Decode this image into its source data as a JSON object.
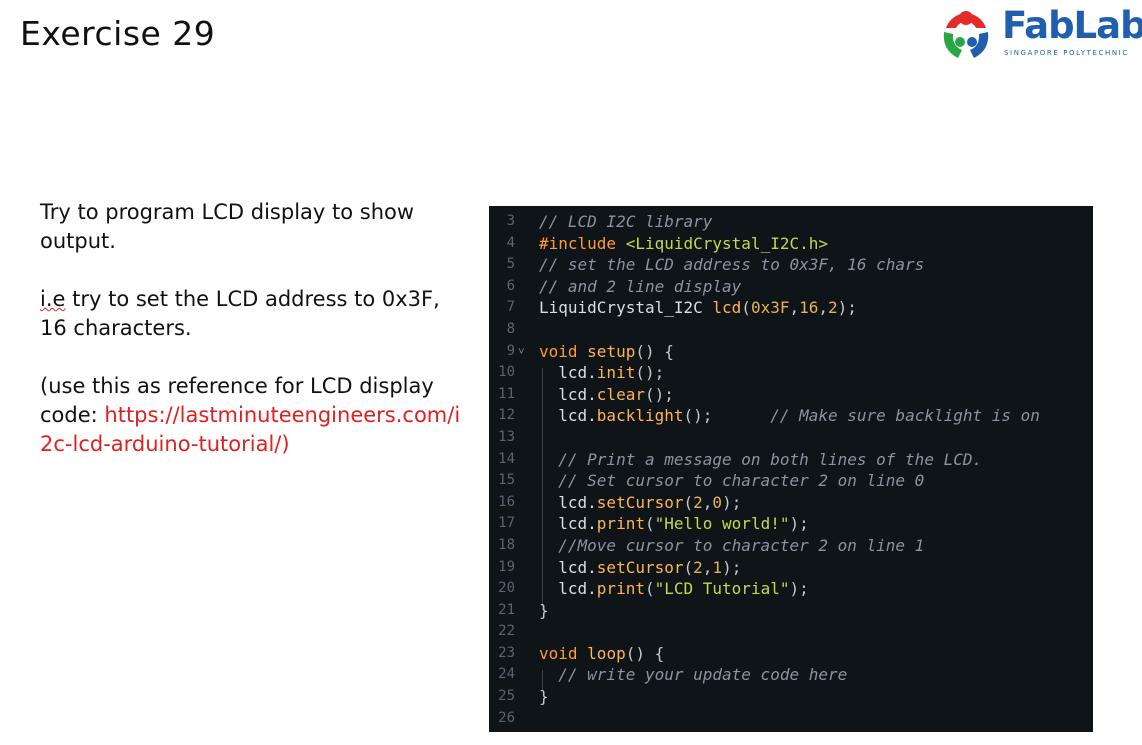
{
  "slide": {
    "title": "Exercise 29"
  },
  "logo": {
    "name": "FabLab",
    "subtitle": "SINGAPORE POLYTECHNIC"
  },
  "instructions": {
    "line1": "Try to program LCD display to show output.",
    "line2_squiggle": "i.e",
    "line2_rest": " try to set the LCD address to 0x3F, 16 characters.",
    "line3": "(use this as reference for LCD display code: ",
    "link": "https://lastminuteengineers.com/i2c-lcd-arduino-tutorial/)"
  },
  "code": {
    "lines": [
      {
        "n": "3",
        "fold": "",
        "parts": [
          [
            "c-com",
            "// LCD I2C library"
          ]
        ]
      },
      {
        "n": "4",
        "fold": "",
        "parts": [
          [
            "c-inc",
            "#include "
          ],
          [
            "c-str",
            "<LiquidCrystal_I2C.h>"
          ]
        ]
      },
      {
        "n": "5",
        "fold": "",
        "parts": [
          [
            "c-com",
            "// set the LCD address to 0x3F, 16 chars"
          ]
        ]
      },
      {
        "n": "6",
        "fold": "",
        "parts": [
          [
            "c-com",
            "// and 2 line display"
          ]
        ]
      },
      {
        "n": "7",
        "fold": "",
        "parts": [
          [
            "",
            "LiquidCrystal_I2C "
          ],
          [
            "c-fn",
            "lcd"
          ],
          [
            "c-pun",
            "("
          ],
          [
            "c-num",
            "0x3F"
          ],
          [
            "c-pun",
            ","
          ],
          [
            "c-num",
            "16"
          ],
          [
            "c-pun",
            ","
          ],
          [
            "c-num",
            "2"
          ],
          [
            "c-pun",
            ");"
          ]
        ]
      },
      {
        "n": "8",
        "fold": "",
        "parts": []
      },
      {
        "n": "9",
        "fold": "˅",
        "parts": [
          [
            "c-kw",
            "void "
          ],
          [
            "c-fn",
            "setup"
          ],
          [
            "c-pun",
            "() {"
          ]
        ]
      },
      {
        "n": "10",
        "fold": "",
        "parts": [
          [
            "",
            "  lcd."
          ],
          [
            "c-fn",
            "init"
          ],
          [
            "c-pun",
            "();"
          ]
        ]
      },
      {
        "n": "11",
        "fold": "",
        "parts": [
          [
            "",
            "  lcd."
          ],
          [
            "c-fn",
            "clear"
          ],
          [
            "c-pun",
            "();"
          ]
        ]
      },
      {
        "n": "12",
        "fold": "",
        "parts": [
          [
            "",
            "  lcd."
          ],
          [
            "c-fn",
            "backlight"
          ],
          [
            "c-pun",
            "();      "
          ],
          [
            "c-com",
            "// Make sure backlight is on"
          ]
        ]
      },
      {
        "n": "13",
        "fold": "",
        "parts": []
      },
      {
        "n": "14",
        "fold": "",
        "parts": [
          [
            "",
            "  "
          ],
          [
            "c-com",
            "// Print a message on both lines of the LCD."
          ]
        ]
      },
      {
        "n": "15",
        "fold": "",
        "parts": [
          [
            "",
            "  "
          ],
          [
            "c-com",
            "// Set cursor to character 2 on line 0"
          ]
        ]
      },
      {
        "n": "16",
        "fold": "",
        "parts": [
          [
            "",
            "  lcd."
          ],
          [
            "c-fn",
            "setCursor"
          ],
          [
            "c-pun",
            "("
          ],
          [
            "c-num",
            "2"
          ],
          [
            "c-pun",
            ","
          ],
          [
            "c-num",
            "0"
          ],
          [
            "c-pun",
            ");"
          ]
        ]
      },
      {
        "n": "17",
        "fold": "",
        "parts": [
          [
            "",
            "  lcd."
          ],
          [
            "c-fn",
            "print"
          ],
          [
            "c-pun",
            "("
          ],
          [
            "c-str",
            "\"Hello world!\""
          ],
          [
            "c-pun",
            ");"
          ]
        ]
      },
      {
        "n": "18",
        "fold": "",
        "parts": [
          [
            "",
            "  "
          ],
          [
            "c-com",
            "//Move cursor to character 2 on line 1"
          ]
        ]
      },
      {
        "n": "19",
        "fold": "",
        "parts": [
          [
            "",
            "  lcd."
          ],
          [
            "c-fn",
            "setCursor"
          ],
          [
            "c-pun",
            "("
          ],
          [
            "c-num",
            "2"
          ],
          [
            "c-pun",
            ","
          ],
          [
            "c-num",
            "1"
          ],
          [
            "c-pun",
            ");"
          ]
        ]
      },
      {
        "n": "20",
        "fold": "",
        "parts": [
          [
            "",
            "  lcd."
          ],
          [
            "c-fn",
            "print"
          ],
          [
            "c-pun",
            "("
          ],
          [
            "c-str",
            "\"LCD Tutorial\""
          ],
          [
            "c-pun",
            ");"
          ]
        ]
      },
      {
        "n": "21",
        "fold": "",
        "parts": [
          [
            "c-pun",
            "}"
          ]
        ]
      },
      {
        "n": "22",
        "fold": "",
        "parts": []
      },
      {
        "n": "23",
        "fold": "",
        "parts": [
          [
            "c-kw",
            "void "
          ],
          [
            "c-fn",
            "loop"
          ],
          [
            "c-pun",
            "() {"
          ]
        ]
      },
      {
        "n": "24",
        "fold": "",
        "parts": [
          [
            "",
            "  "
          ],
          [
            "c-com",
            "// write your update code here"
          ]
        ]
      },
      {
        "n": "25",
        "fold": "",
        "parts": [
          [
            "c-pun",
            "}"
          ]
        ]
      },
      {
        "n": "26",
        "fold": "",
        "parts": []
      }
    ]
  }
}
